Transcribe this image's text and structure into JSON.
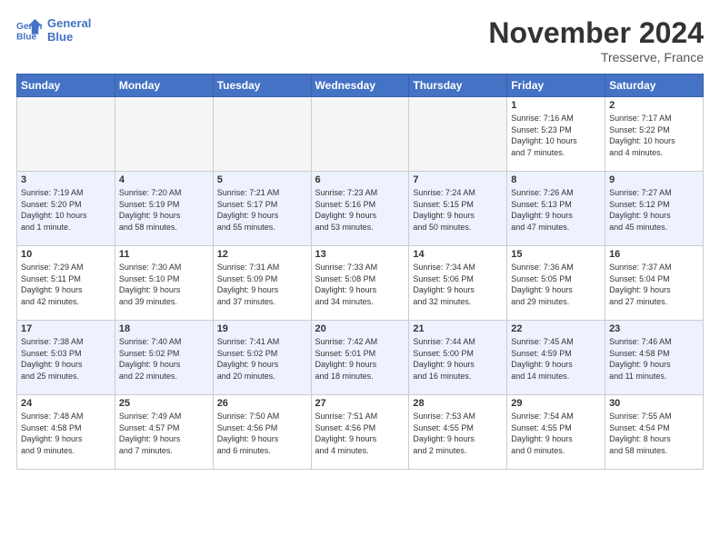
{
  "header": {
    "logo_line1": "General",
    "logo_line2": "Blue",
    "month": "November 2024",
    "location": "Tresserve, France"
  },
  "weekdays": [
    "Sunday",
    "Monday",
    "Tuesday",
    "Wednesday",
    "Thursday",
    "Friday",
    "Saturday"
  ],
  "weeks": [
    [
      {
        "day": "",
        "info": ""
      },
      {
        "day": "",
        "info": ""
      },
      {
        "day": "",
        "info": ""
      },
      {
        "day": "",
        "info": ""
      },
      {
        "day": "",
        "info": ""
      },
      {
        "day": "1",
        "info": "Sunrise: 7:16 AM\nSunset: 5:23 PM\nDaylight: 10 hours\nand 7 minutes."
      },
      {
        "day": "2",
        "info": "Sunrise: 7:17 AM\nSunset: 5:22 PM\nDaylight: 10 hours\nand 4 minutes."
      }
    ],
    [
      {
        "day": "3",
        "info": "Sunrise: 7:19 AM\nSunset: 5:20 PM\nDaylight: 10 hours\nand 1 minute."
      },
      {
        "day": "4",
        "info": "Sunrise: 7:20 AM\nSunset: 5:19 PM\nDaylight: 9 hours\nand 58 minutes."
      },
      {
        "day": "5",
        "info": "Sunrise: 7:21 AM\nSunset: 5:17 PM\nDaylight: 9 hours\nand 55 minutes."
      },
      {
        "day": "6",
        "info": "Sunrise: 7:23 AM\nSunset: 5:16 PM\nDaylight: 9 hours\nand 53 minutes."
      },
      {
        "day": "7",
        "info": "Sunrise: 7:24 AM\nSunset: 5:15 PM\nDaylight: 9 hours\nand 50 minutes."
      },
      {
        "day": "8",
        "info": "Sunrise: 7:26 AM\nSunset: 5:13 PM\nDaylight: 9 hours\nand 47 minutes."
      },
      {
        "day": "9",
        "info": "Sunrise: 7:27 AM\nSunset: 5:12 PM\nDaylight: 9 hours\nand 45 minutes."
      }
    ],
    [
      {
        "day": "10",
        "info": "Sunrise: 7:29 AM\nSunset: 5:11 PM\nDaylight: 9 hours\nand 42 minutes."
      },
      {
        "day": "11",
        "info": "Sunrise: 7:30 AM\nSunset: 5:10 PM\nDaylight: 9 hours\nand 39 minutes."
      },
      {
        "day": "12",
        "info": "Sunrise: 7:31 AM\nSunset: 5:09 PM\nDaylight: 9 hours\nand 37 minutes."
      },
      {
        "day": "13",
        "info": "Sunrise: 7:33 AM\nSunset: 5:08 PM\nDaylight: 9 hours\nand 34 minutes."
      },
      {
        "day": "14",
        "info": "Sunrise: 7:34 AM\nSunset: 5:06 PM\nDaylight: 9 hours\nand 32 minutes."
      },
      {
        "day": "15",
        "info": "Sunrise: 7:36 AM\nSunset: 5:05 PM\nDaylight: 9 hours\nand 29 minutes."
      },
      {
        "day": "16",
        "info": "Sunrise: 7:37 AM\nSunset: 5:04 PM\nDaylight: 9 hours\nand 27 minutes."
      }
    ],
    [
      {
        "day": "17",
        "info": "Sunrise: 7:38 AM\nSunset: 5:03 PM\nDaylight: 9 hours\nand 25 minutes."
      },
      {
        "day": "18",
        "info": "Sunrise: 7:40 AM\nSunset: 5:02 PM\nDaylight: 9 hours\nand 22 minutes."
      },
      {
        "day": "19",
        "info": "Sunrise: 7:41 AM\nSunset: 5:02 PM\nDaylight: 9 hours\nand 20 minutes."
      },
      {
        "day": "20",
        "info": "Sunrise: 7:42 AM\nSunset: 5:01 PM\nDaylight: 9 hours\nand 18 minutes."
      },
      {
        "day": "21",
        "info": "Sunrise: 7:44 AM\nSunset: 5:00 PM\nDaylight: 9 hours\nand 16 minutes."
      },
      {
        "day": "22",
        "info": "Sunrise: 7:45 AM\nSunset: 4:59 PM\nDaylight: 9 hours\nand 14 minutes."
      },
      {
        "day": "23",
        "info": "Sunrise: 7:46 AM\nSunset: 4:58 PM\nDaylight: 9 hours\nand 11 minutes."
      }
    ],
    [
      {
        "day": "24",
        "info": "Sunrise: 7:48 AM\nSunset: 4:58 PM\nDaylight: 9 hours\nand 9 minutes."
      },
      {
        "day": "25",
        "info": "Sunrise: 7:49 AM\nSunset: 4:57 PM\nDaylight: 9 hours\nand 7 minutes."
      },
      {
        "day": "26",
        "info": "Sunrise: 7:50 AM\nSunset: 4:56 PM\nDaylight: 9 hours\nand 6 minutes."
      },
      {
        "day": "27",
        "info": "Sunrise: 7:51 AM\nSunset: 4:56 PM\nDaylight: 9 hours\nand 4 minutes."
      },
      {
        "day": "28",
        "info": "Sunrise: 7:53 AM\nSunset: 4:55 PM\nDaylight: 9 hours\nand 2 minutes."
      },
      {
        "day": "29",
        "info": "Sunrise: 7:54 AM\nSunset: 4:55 PM\nDaylight: 9 hours\nand 0 minutes."
      },
      {
        "day": "30",
        "info": "Sunrise: 7:55 AM\nSunset: 4:54 PM\nDaylight: 8 hours\nand 58 minutes."
      }
    ]
  ]
}
